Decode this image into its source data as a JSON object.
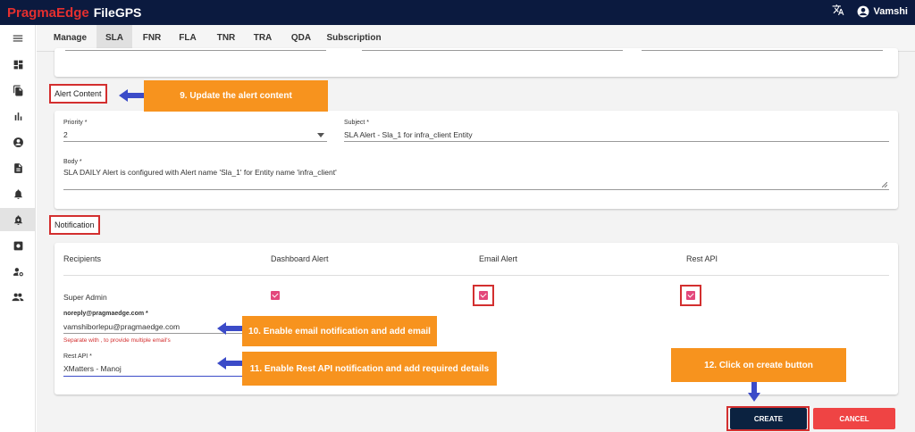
{
  "header": {
    "brand": "PragmaEdge",
    "product": "FileGPS",
    "user_name": "Vamshi",
    "translate_icon": "translate-icon",
    "account_icon": "account-circle-icon"
  },
  "sidebar": {
    "items": [
      {
        "icon": "menu-icon"
      },
      {
        "icon": "dashboard-icon"
      },
      {
        "icon": "files-icon"
      },
      {
        "icon": "bar-chart-icon"
      },
      {
        "icon": "account-icon"
      },
      {
        "icon": "document-icon"
      },
      {
        "icon": "bell-icon"
      },
      {
        "icon": "alert-add-icon"
      },
      {
        "icon": "settings-box-icon"
      },
      {
        "icon": "user-settings-icon"
      },
      {
        "icon": "group-icon"
      }
    ]
  },
  "tabs": [
    {
      "label": "Manage"
    },
    {
      "label": "SLA"
    },
    {
      "label": "FNR"
    },
    {
      "label": "FLA"
    },
    {
      "label": "TNR"
    },
    {
      "label": "TRA"
    },
    {
      "label": "QDA"
    },
    {
      "label": "Subscription"
    }
  ],
  "alert_content": {
    "title": "Alert Content",
    "priority_label": "Priority *",
    "priority_value": "2",
    "subject_label": "Subject *",
    "subject_value": "SLA Alert - Sla_1 for infra_client Entity",
    "body_label": "Body *",
    "body_value": "SLA DAILY Alert is configured with Alert name 'Sla_1' for Entity name 'infra_client'"
  },
  "notification": {
    "title": "Notification",
    "columns": [
      "Recipients",
      "Dashboard Alert",
      "Email Alert",
      "Rest API"
    ],
    "row_label": "Super Admin",
    "dashboard_checked": true,
    "email_checked": true,
    "rest_checked": true,
    "email_field_label": "noreply@pragmaedge.com *",
    "email_field_value": "vamshiborlepu@pragmaedge.com",
    "email_helper": "Separate with , to provide multiple email's",
    "rest_field_label": "Rest API *",
    "rest_field_value": "XMatters - Manoj"
  },
  "buttons": {
    "create": "CREATE",
    "cancel": "CANCEL"
  },
  "annotations": {
    "a9": "9. Update the alert content",
    "a10": "10. Enable email notification and add email",
    "a11": "11. Enable Rest API notification and add required details",
    "a12": "12. Click on create button"
  },
  "colors": {
    "header_bg": "#0b1a3f",
    "brand_red": "#e42f2f",
    "checkbox": "#e3477b",
    "create_bg": "#0b2240",
    "cancel_bg": "#ef4444",
    "annotation_bg": "#f7931e",
    "arrow": "#3b4bc8",
    "highlight": "#d32f2f"
  }
}
